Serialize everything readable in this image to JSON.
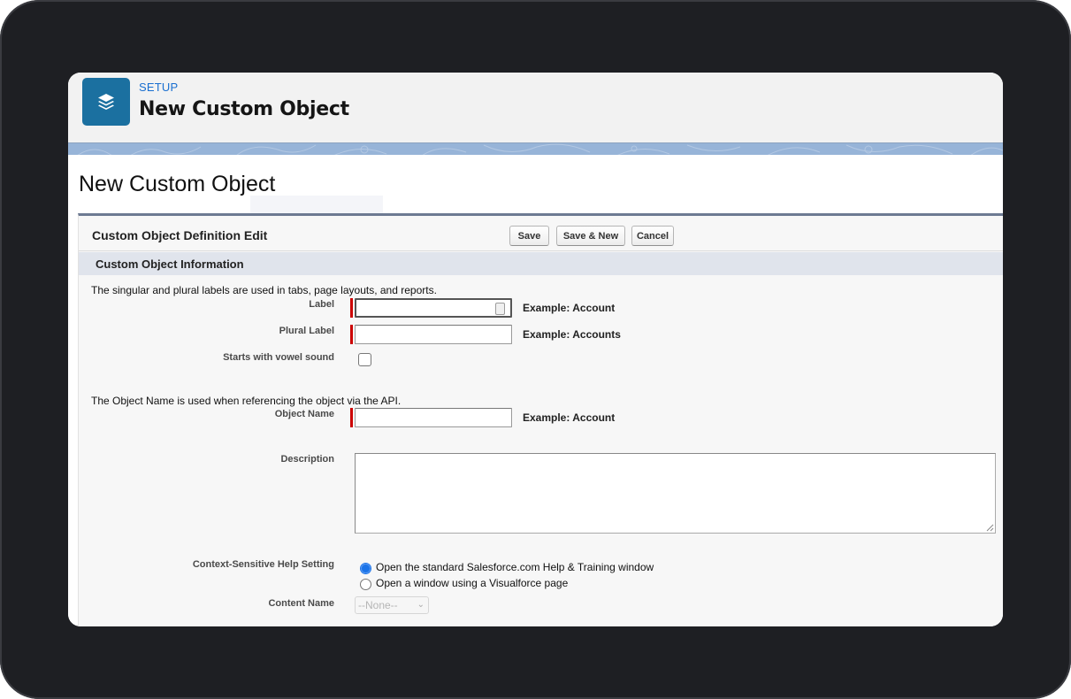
{
  "header": {
    "kicker": "SETUP",
    "title": "New Custom Object",
    "icon": "stacked-layers-icon",
    "icon_bg": "#1b70a0"
  },
  "page": {
    "title": "New Custom Object"
  },
  "panel": {
    "title": "Custom Object Definition Edit",
    "buttons": {
      "save": "Save",
      "save_new": "Save & New",
      "cancel": "Cancel"
    },
    "section_title": "Custom Object Information"
  },
  "form": {
    "labels_note": "The singular and plural labels are used in tabs, page layouts, and reports.",
    "label": {
      "label": "Label",
      "value": "",
      "example": "Example:  Account",
      "required": true
    },
    "plural_label": {
      "label": "Plural Label",
      "value": "",
      "example": "Example:  Accounts",
      "required": true
    },
    "vowel": {
      "label": "Starts with vowel sound",
      "checked": false
    },
    "api_note": "The Object Name is used when referencing the object via the API.",
    "object_name": {
      "label": "Object Name",
      "value": "",
      "example": "Example:  Account",
      "required": true
    },
    "description": {
      "label": "Description",
      "value": ""
    },
    "help_setting": {
      "label": "Context-Sensitive Help Setting",
      "options": [
        {
          "label": "Open the standard Salesforce.com Help & Training window",
          "selected": true
        },
        {
          "label": "Open a window using a Visualforce page",
          "selected": false
        }
      ]
    },
    "content_name": {
      "label": "Content Name",
      "selected": "--None--",
      "disabled": true
    }
  },
  "colors": {
    "required": "#cc0000",
    "link_blue": "#1a6fd0",
    "section_bg": "#e0e4ec",
    "banner": "#97b4d8"
  }
}
